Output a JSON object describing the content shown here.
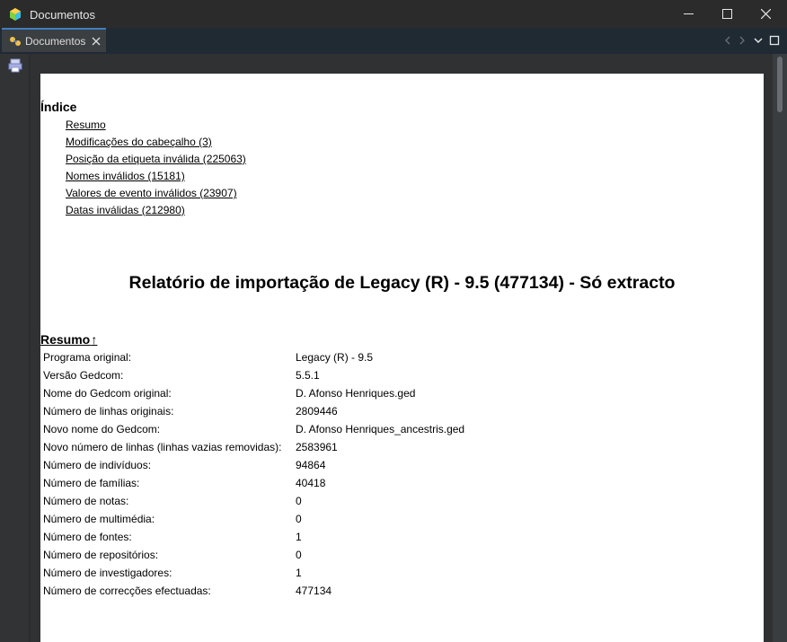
{
  "window": {
    "title": "Documentos"
  },
  "tab": {
    "label": "Documentos"
  },
  "report": {
    "index_heading": "Índice",
    "toc": [
      "Resumo",
      "Modificações do cabeçalho (3)",
      "Posição da etiqueta inválida (225063)",
      "Nomes inválidos (15181)",
      "Valores de evento inválidos (23907)",
      "Datas inválidas (212980)"
    ],
    "title": "Relatório de importação de Legacy (R) - 9.5 (477134) - Só extracto",
    "summary_heading": "Resumo",
    "up_arrow": "↑",
    "summary": [
      {
        "label": "Programa original:",
        "value": "Legacy (R) - 9.5"
      },
      {
        "label": "Versão Gedcom:",
        "value": "5.5.1"
      },
      {
        "label": "Nome do Gedcom original:",
        "value": "D. Afonso Henriques.ged"
      },
      {
        "label": "Número de linhas originais:",
        "value": "2809446"
      },
      {
        "label": "Novo nome do Gedcom:",
        "value": "D. Afonso Henriques_ancestris.ged"
      },
      {
        "label": "Novo número de linhas (linhas vazias removidas):",
        "value": "2583961"
      },
      {
        "label": "Número de indivíduos:",
        "value": "94864"
      },
      {
        "label": "Número de famílias:",
        "value": "40418"
      },
      {
        "label": "Número de notas:",
        "value": "0"
      },
      {
        "label": "Número de multimédia:",
        "value": "0"
      },
      {
        "label": "Número de fontes:",
        "value": "1"
      },
      {
        "label": "Número de repositórios:",
        "value": "0"
      },
      {
        "label": "Número de investigadores:",
        "value": "1"
      },
      {
        "label": "Número de correcções efectuadas:",
        "value": "477134"
      }
    ]
  },
  "colors": {
    "accent": "#3d7fbf",
    "page_bg": "#ffffff",
    "chrome_bg": "#2b2b2b"
  }
}
